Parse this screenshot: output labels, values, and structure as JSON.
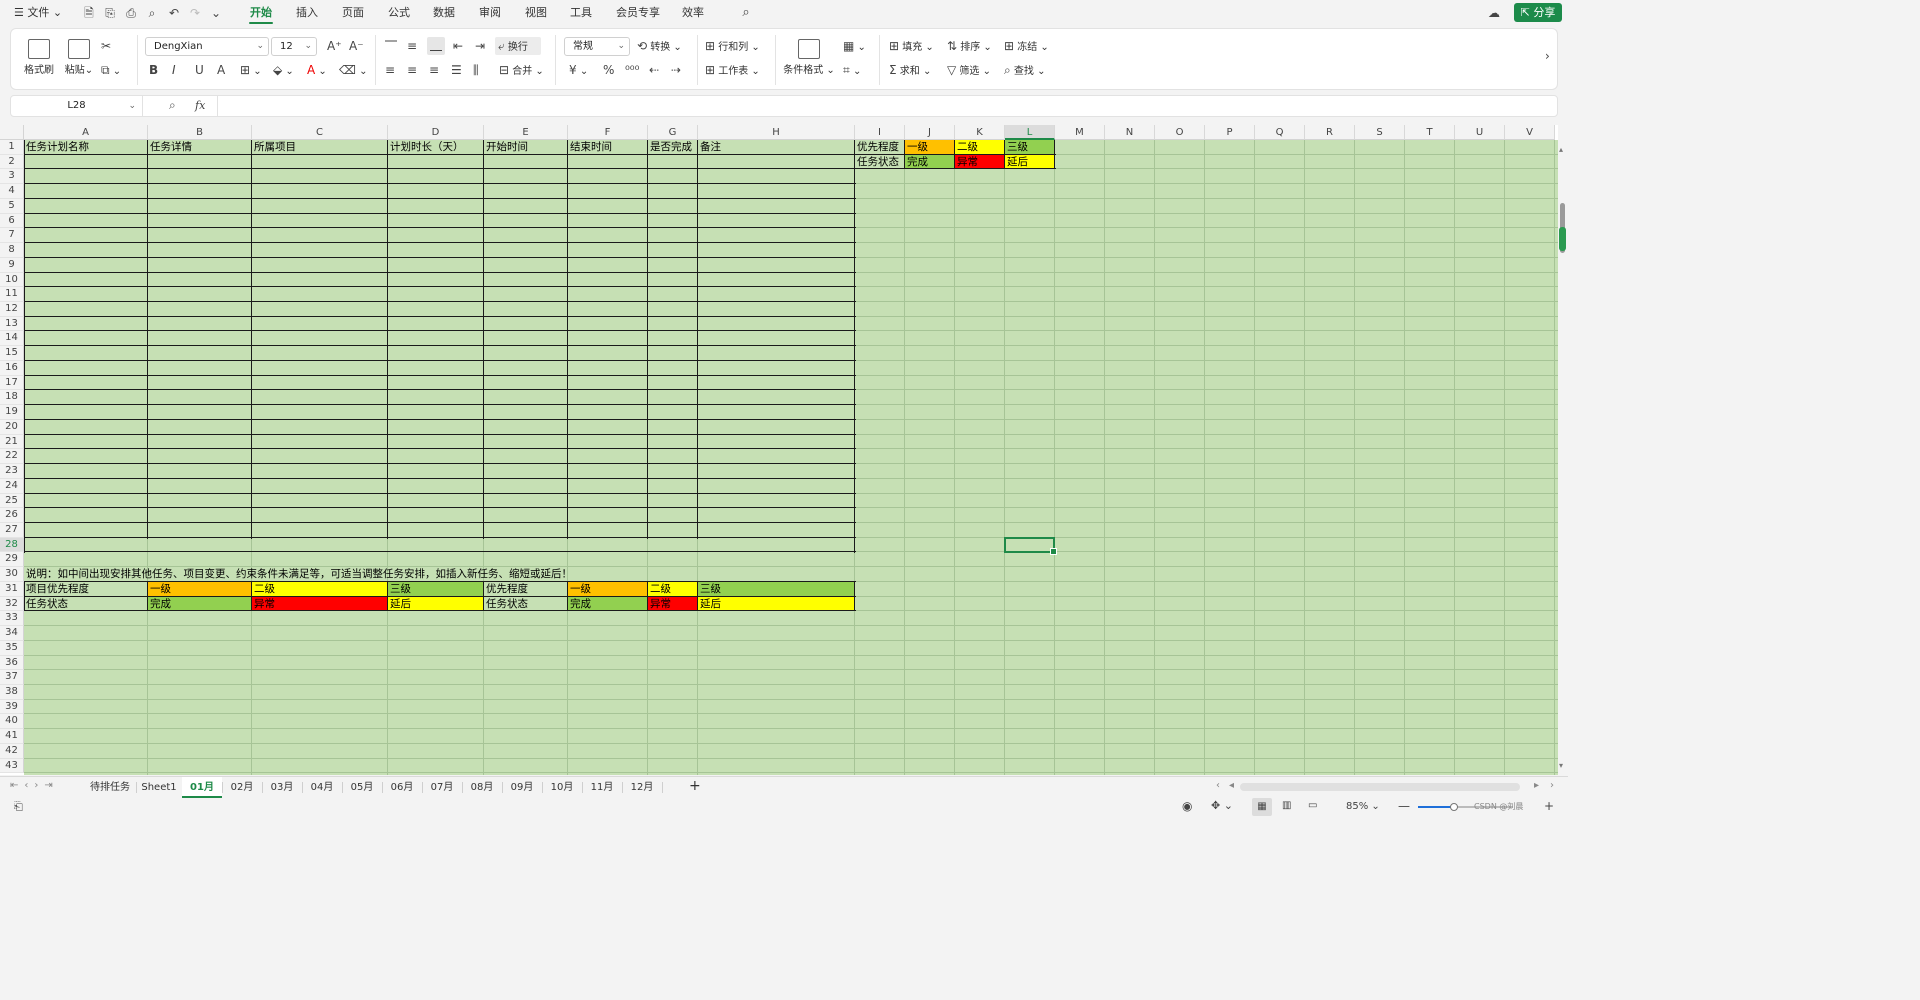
{
  "menu": {
    "file": "文件",
    "tabs": [
      "开始",
      "插入",
      "页面",
      "公式",
      "数据",
      "审阅",
      "视图",
      "工具",
      "会员专享",
      "效率"
    ],
    "active_tab": "开始",
    "share": "分享"
  },
  "ribbon": {
    "format_painter": "格式刷",
    "paste": "粘贴",
    "font_name": "DengXian",
    "font_size": "12",
    "wrap": "换行",
    "merge": "合并",
    "number_format": "常规",
    "convert": "转换",
    "rows_cols": "行和列",
    "worksheet": "工作表",
    "cond_format": "条件格式",
    "fill": "填充",
    "sort": "排序",
    "freeze": "冻结",
    "sum": "求和",
    "filter": "筛选",
    "find": "查找",
    "currency_symbol": "¥",
    "percent_symbol": "%"
  },
  "formula_bar": {
    "name_box": "L28",
    "fx": "fx",
    "value": ""
  },
  "columns": [
    "A",
    "B",
    "C",
    "D",
    "E",
    "F",
    "G",
    "H",
    "I",
    "J",
    "K",
    "L",
    "M",
    "N",
    "O",
    "P",
    "Q",
    "R",
    "S",
    "T",
    "U",
    "V"
  ],
  "selected_column": "L",
  "selected_row": 28,
  "rows": [
    1,
    2,
    3,
    4,
    5,
    6,
    7,
    8,
    9,
    10,
    11,
    12,
    13,
    14,
    15,
    16,
    17,
    18,
    19,
    20,
    21,
    22,
    23,
    24,
    25,
    26,
    27,
    28,
    29,
    30,
    31,
    32,
    33,
    34,
    35,
    36,
    37,
    38,
    39,
    40,
    41,
    42,
    43
  ],
  "sheet": {
    "headers": [
      "任务计划名称",
      "任务详情",
      "所属项目",
      "计划时长（天）",
      "开始时间",
      "结束时间",
      "是否完成",
      "备注"
    ],
    "note": "说明：如中间出现安排其他任务、项目变更、约束条件未满足等，可适当调整任务安排，如插入新任务、缩短或延后！",
    "legend": {
      "r31": [
        "项目优先程度",
        "一级",
        "二级",
        "三级",
        "优先程度",
        "一级",
        "二级",
        "三级"
      ],
      "r32": [
        "任务状态",
        "完成",
        "异常",
        "延后",
        "任务状态",
        "完成",
        "异常",
        "延后"
      ]
    },
    "side": {
      "r1": [
        "优先程度",
        "一级",
        "二级",
        "三级"
      ],
      "r2": [
        "任务状态",
        "完成",
        "异常",
        "延后"
      ]
    }
  },
  "colors": {
    "accent": "#1e8a48",
    "sheet_bg": "#c6e0b4",
    "orange": "#ffc000",
    "yellow": "#ffff00",
    "green": "#92d050",
    "red": "#ff0000"
  },
  "sheet_tabs": [
    "待排任务",
    "Sheet1",
    "01月",
    "02月",
    "03月",
    "04月",
    "05月",
    "06月",
    "07月",
    "08月",
    "09月",
    "10月",
    "11月",
    "12月"
  ],
  "active_sheet": "01月",
  "status": {
    "zoom": "85%",
    "zoom_level": 0.38,
    "watermark": "CSDN @刘晨"
  }
}
